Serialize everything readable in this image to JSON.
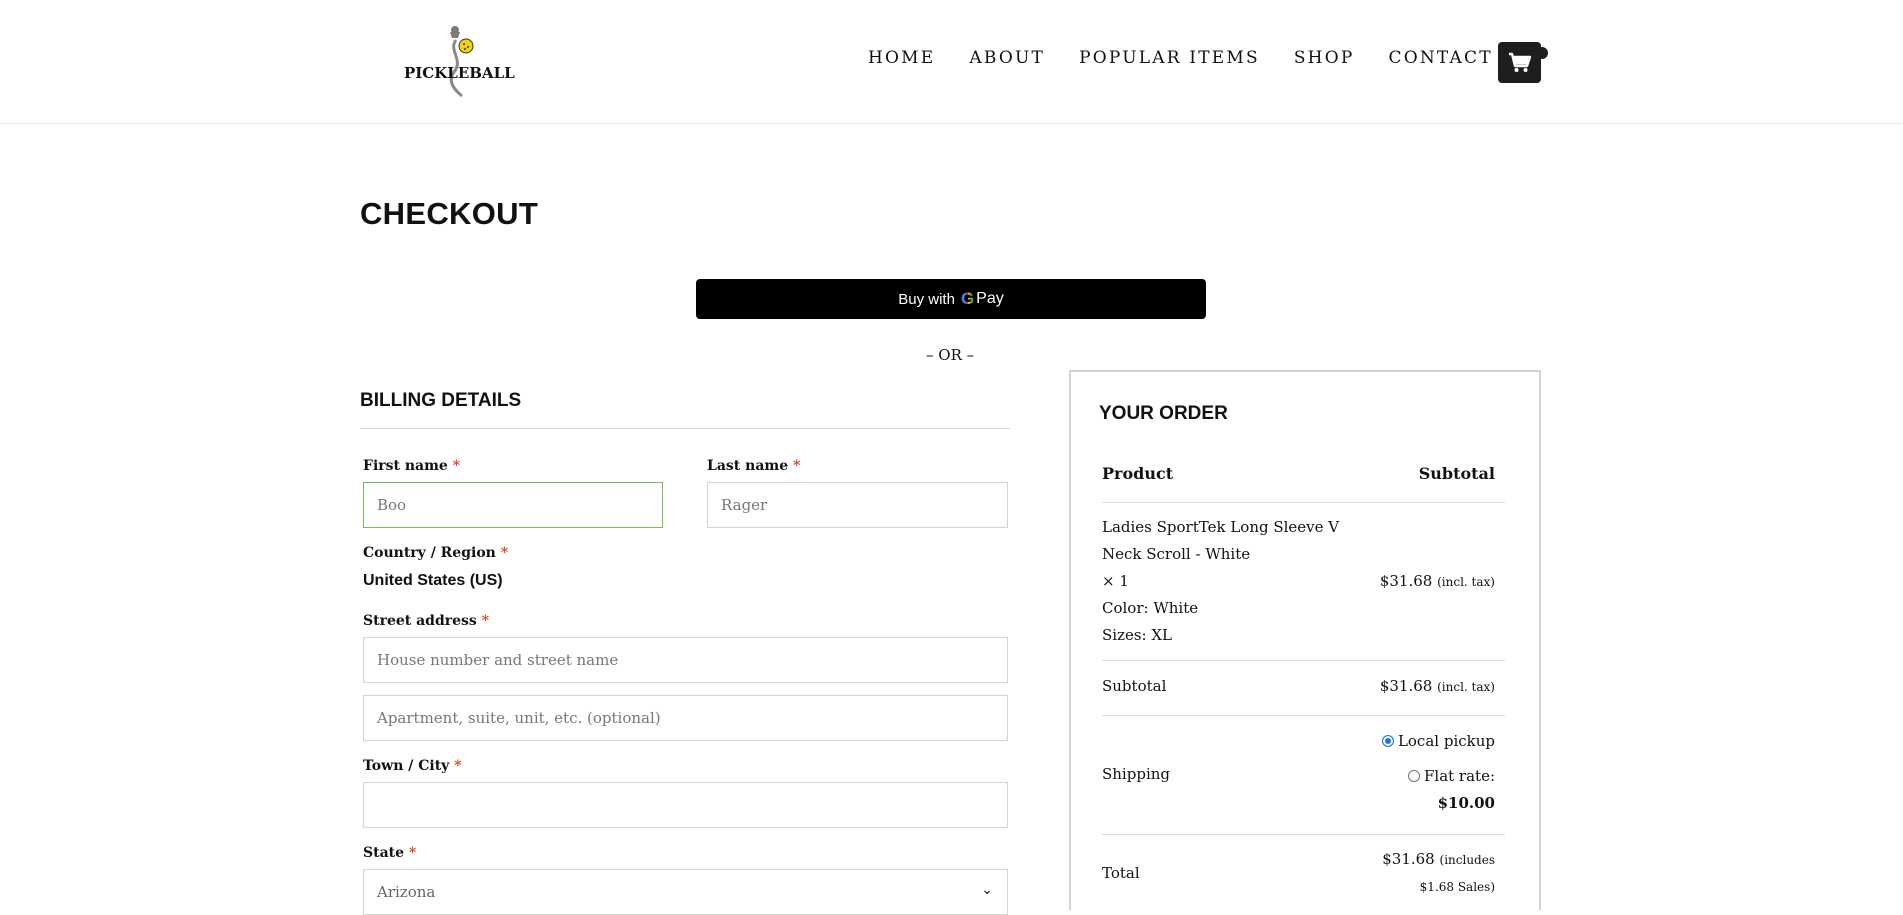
{
  "header": {
    "logo_text": "PICKLEBALL",
    "nav": [
      "HOME",
      "ABOUT",
      "POPULAR ITEMS",
      "SHOP",
      "CONTACT"
    ]
  },
  "page": {
    "title": "CHECKOUT",
    "gpay": {
      "prefix": "Buy with",
      "g": "G",
      "pay": "Pay"
    },
    "or_text": "– OR –"
  },
  "billing": {
    "heading": "BILLING DETAILS",
    "required_mark": "*",
    "first_name": {
      "label": "First name",
      "value": "Boo"
    },
    "last_name": {
      "label": "Last name",
      "value": "Rager"
    },
    "country": {
      "label": "Country / Region",
      "value": "United States (US)"
    },
    "street": {
      "label": "Street address",
      "placeholder_1": "House number and street name",
      "placeholder_2": "Apartment, suite, unit, etc. (optional)"
    },
    "city": {
      "label": "Town / City",
      "value": ""
    },
    "state": {
      "label": "State",
      "value": "Arizona"
    }
  },
  "order": {
    "heading": "YOUR ORDER",
    "col_product": "Product",
    "col_subtotal": "Subtotal",
    "item": {
      "name_line1": "Ladies SportTek Long Sleeve V",
      "name_line2": "Neck Scroll - White",
      "qty": "× 1",
      "color": "Color: White",
      "size": "Sizes: XL",
      "price": "$31.68",
      "tax_note": "(incl. tax)"
    },
    "subtotal": {
      "label": "Subtotal",
      "value": "$31.68",
      "tax_note": "(incl. tax)"
    },
    "shipping": {
      "label": "Shipping",
      "options": [
        {
          "label": "Local pickup",
          "checked": true
        },
        {
          "label": "Flat rate:",
          "price": "$10.00",
          "checked": false
        }
      ]
    },
    "total": {
      "label": "Total",
      "value": "$31.68",
      "note_1": "(includes",
      "note_2": "$1.68 Sales)"
    }
  },
  "colors": {
    "focus_border": "#7dbb55",
    "required": "#e2401c",
    "cart_bg": "#1e1e1e"
  }
}
